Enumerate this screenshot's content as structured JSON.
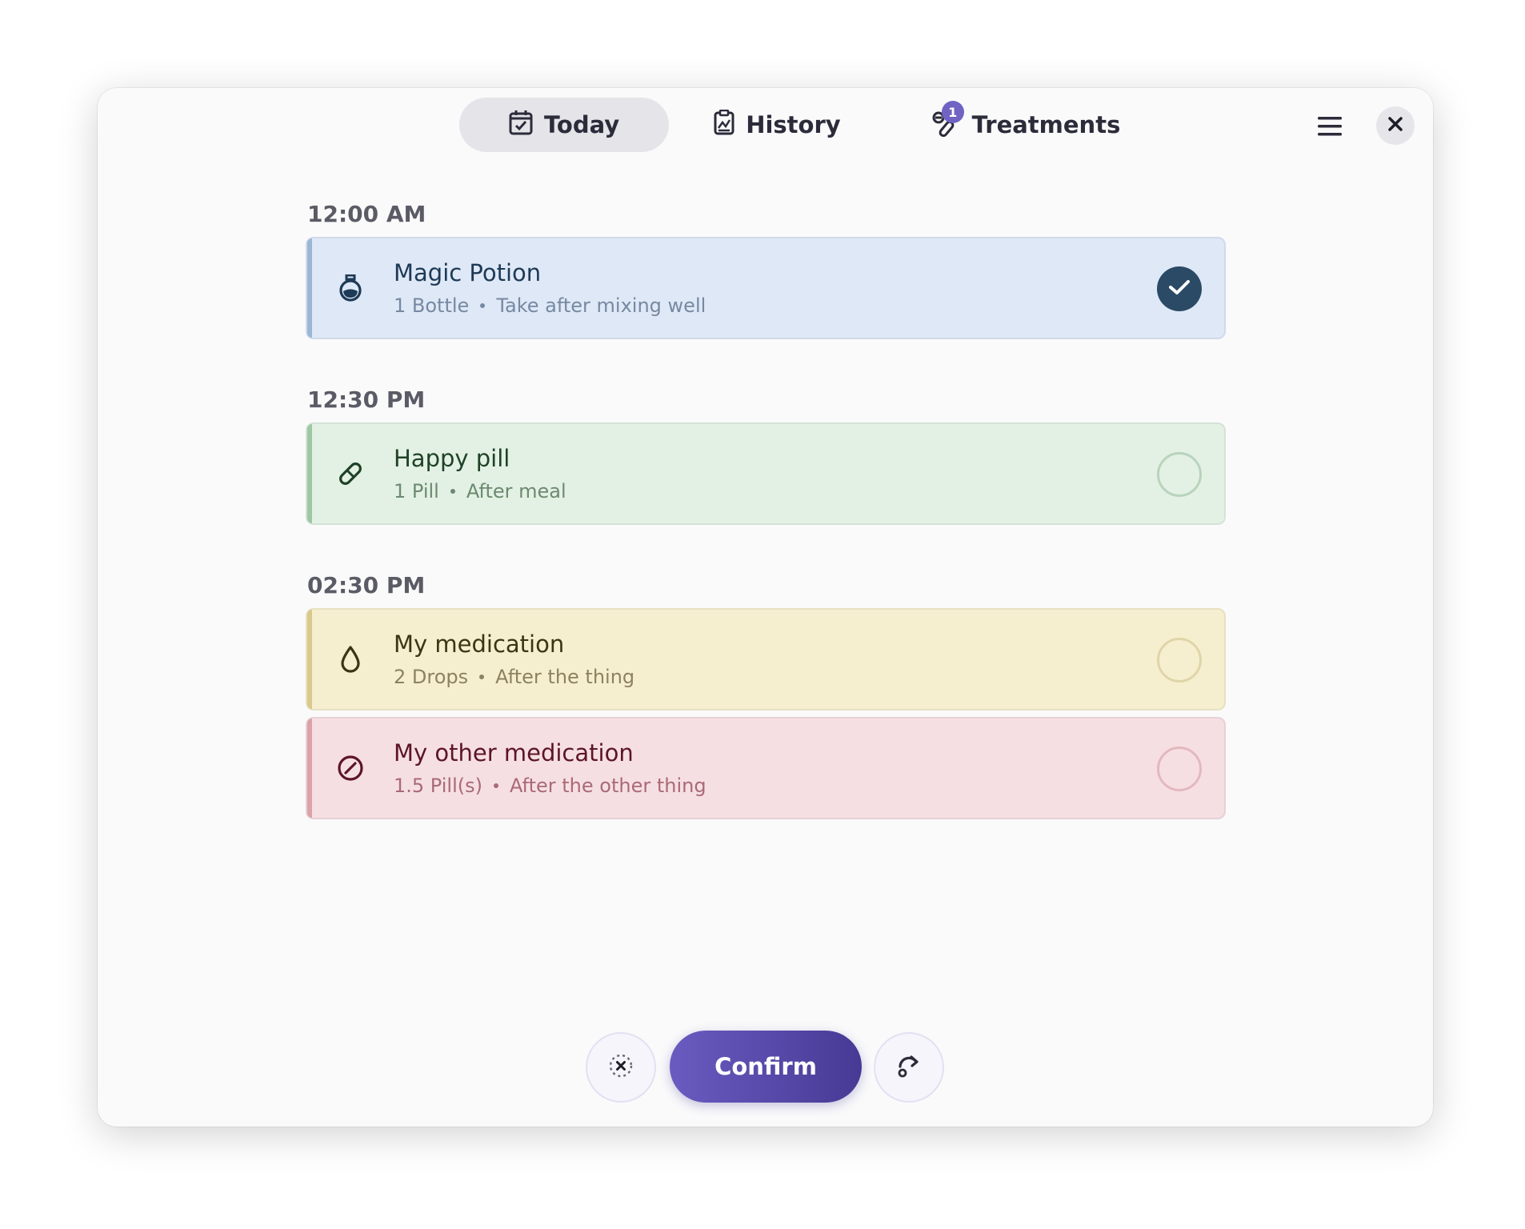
{
  "tabs": [
    {
      "label": "Today",
      "icon": "calendar-check-icon",
      "active": true
    },
    {
      "label": "History",
      "icon": "clipboard-history-icon",
      "active": false
    },
    {
      "label": "Treatments",
      "icon": "pills-icon",
      "active": false,
      "badge": "1"
    }
  ],
  "header": {
    "menu_icon": "hamburger-menu-icon",
    "close_icon": "close-icon"
  },
  "schedule": [
    {
      "time": "12:00 AM",
      "items": [
        {
          "name": "Magic Potion",
          "dose": "1 Bottle",
          "note": "Take after mixing well",
          "color": "blue",
          "icon": "potion-icon",
          "taken": true
        }
      ]
    },
    {
      "time": "12:30 PM",
      "items": [
        {
          "name": "Happy pill",
          "dose": "1 Pill",
          "note": "After meal",
          "color": "green",
          "icon": "pill-icon",
          "taken": false
        }
      ]
    },
    {
      "time": "02:30 PM",
      "items": [
        {
          "name": "My medication",
          "dose": "2 Drops",
          "note": "After the thing",
          "color": "yellow",
          "icon": "drop-icon",
          "taken": false
        },
        {
          "name": "My other medication",
          "dose": "1.5 Pill(s)",
          "note": "After the other thing",
          "color": "red",
          "icon": "prohibited-icon",
          "taken": false
        }
      ]
    }
  ],
  "actions": {
    "skip_icon": "skip-dashed-circle-icon",
    "confirm_label": "Confirm",
    "reschedule_icon": "reschedule-icon"
  },
  "colors": {
    "accent": "#5a4db0",
    "taken_check": "#2b4a66"
  }
}
